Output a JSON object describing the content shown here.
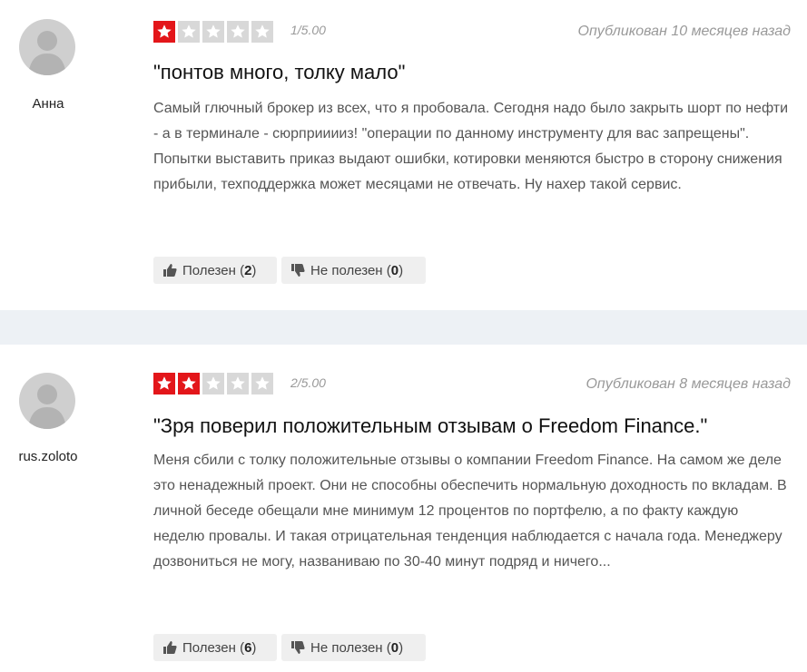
{
  "reviews": [
    {
      "author": "Анна",
      "rating": 1,
      "score_text": "1/5.00",
      "published": "Опубликован 10 месяцев назад",
      "title": "\"понтов много, толку мало\"",
      "body": "Самый глючный брокер из всех, что я пробовала. Сегодня надо было закрыть шорт по нефти - а в терминале - сюрприиииз! \"операции по данному инструменту для вас запрещены\". Попытки выставить приказ выдают ошибки, котировки меняются быстро в сторону снижения прибыли, техподдержка может месяцами не отвечать. Ну нахер такой сервис.",
      "helpful_label": "Полезен",
      "helpful_count": "2",
      "not_helpful_label": "Не полезен",
      "not_helpful_count": "0"
    },
    {
      "author": "rus.zoloto",
      "rating": 2,
      "score_text": "2/5.00",
      "published": "Опубликован 8 месяцев назад",
      "title": "\"Зря поверил положительным отзывам о Freedom Finance.\"",
      "body": "Меня сбили с толку положительные отзывы о компании Freedom Finance. На самом же деле это ненадежный проект. Они не способны обеспечить нормальную доходность по вкладам. В личной беседе обещали мне минимум 12 процентов по портфелю, а по факту каждую неделю провалы. И такая отрицательная тенденция наблюдается с начала года. Менеджеру дозвониться не могу, названиваю по 30-40 минут подряд и ничего...",
      "helpful_label": "Полезен",
      "helpful_count": "6",
      "not_helpful_label": "Не полезен",
      "not_helpful_count": "0"
    }
  ],
  "colors": {
    "star_on": "#e3161a",
    "star_off": "#d8d8d8",
    "divider": "#edf1f5",
    "button_bg": "#efefef"
  },
  "icons": {
    "avatar": "user-silhouette-icon",
    "star": "star-icon",
    "helpful": "thumbs-up-icon",
    "not_helpful": "thumbs-down-icon"
  }
}
